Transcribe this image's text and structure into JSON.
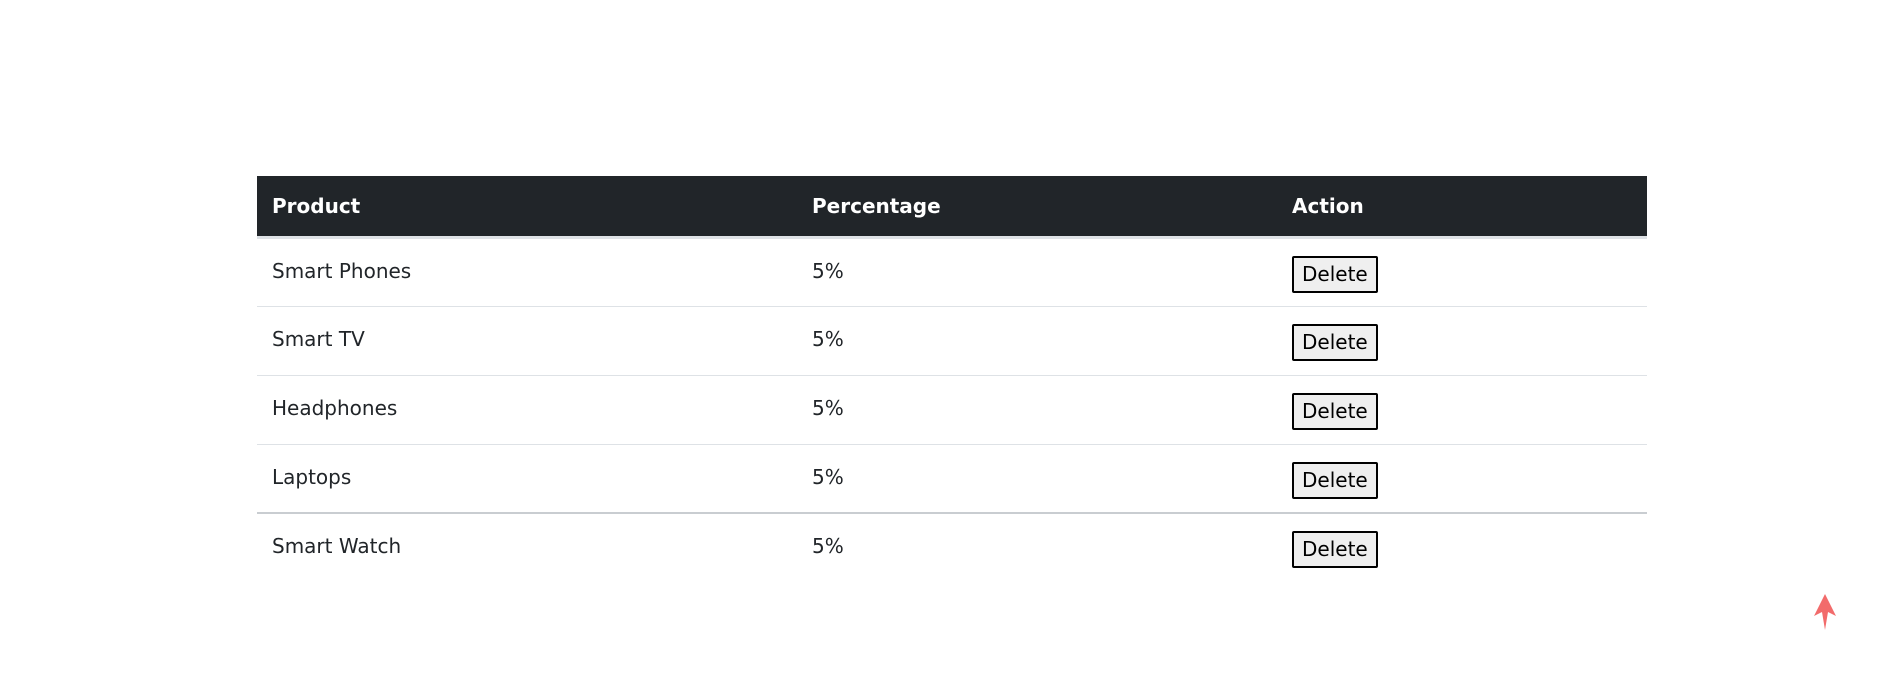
{
  "table": {
    "headers": {
      "product": "Product",
      "percentage": "Percentage",
      "action": "Action"
    },
    "rows": [
      {
        "product": "Smart Phones",
        "percentage": "5%",
        "action": "Delete"
      },
      {
        "product": "Smart TV",
        "percentage": "5%",
        "action": "Delete"
      },
      {
        "product": "Headphones",
        "percentage": "5%",
        "action": "Delete"
      },
      {
        "product": "Laptops",
        "percentage": "5%",
        "action": "Delete"
      },
      {
        "product": "Smart Watch",
        "percentage": "5%",
        "action": "Delete"
      }
    ]
  },
  "scroll_top": {
    "icon": "arrow-up-icon",
    "color": "#f26b6b"
  },
  "colors": {
    "header_bg": "#212529",
    "header_text": "#ffffff",
    "body_text": "#212529"
  }
}
